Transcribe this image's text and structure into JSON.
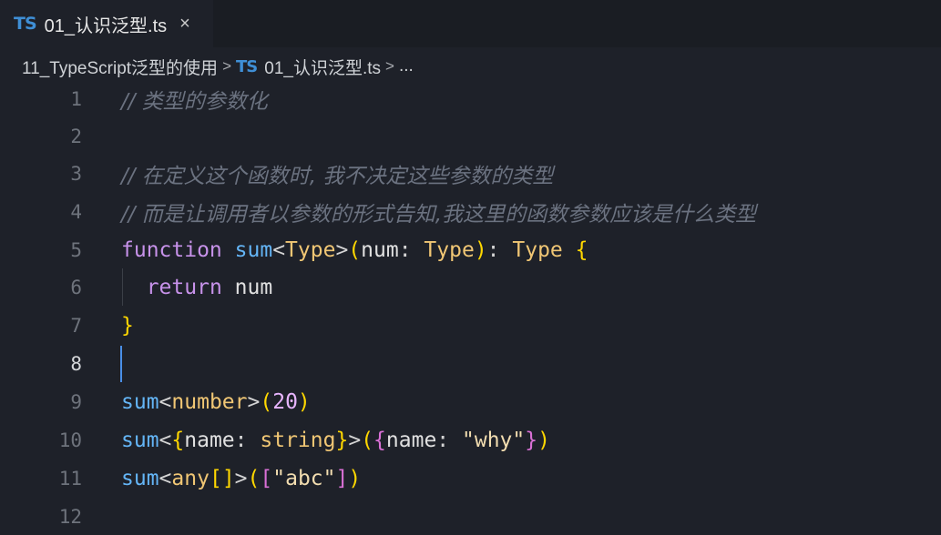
{
  "tab": {
    "icon": "TS",
    "title": "01_认识泛型.ts",
    "close": "×"
  },
  "breadcrumb": {
    "folder": "11_TypeScript泛型的使用",
    "sep": ">",
    "file_icon": "TS",
    "file": "01_认识泛型.ts",
    "more": "..."
  },
  "editor": {
    "active_line": 8,
    "lines": [
      {
        "n": "1",
        "t": "// 类型的参数化"
      },
      {
        "n": "2",
        "t": ""
      },
      {
        "n": "3",
        "t": "// 在定义这个函数时, 我不决定这些参数的类型"
      },
      {
        "n": "4",
        "t": "// 而是让调用者以参数的形式告知,我这里的函数参数应该是什么类型"
      },
      {
        "n": "5",
        "t": "function sum<Type>(num: Type): Type {"
      },
      {
        "n": "6",
        "t": "  return num"
      },
      {
        "n": "7",
        "t": "}"
      },
      {
        "n": "8",
        "t": ""
      },
      {
        "n": "9",
        "t": "sum<number>(20)"
      },
      {
        "n": "10",
        "t": "sum<{name: string}>({name: \"why\"})"
      },
      {
        "n": "11",
        "t": "sum<any[]>([\"abc\"])"
      },
      {
        "n": "12",
        "t": ""
      }
    ]
  },
  "colors": {
    "background": "#1e2129",
    "keyword": "#c792ea",
    "function": "#64b5f6",
    "type": "#f0c674",
    "comment": "#6b7280",
    "ts_icon": "#3f8fd6"
  }
}
